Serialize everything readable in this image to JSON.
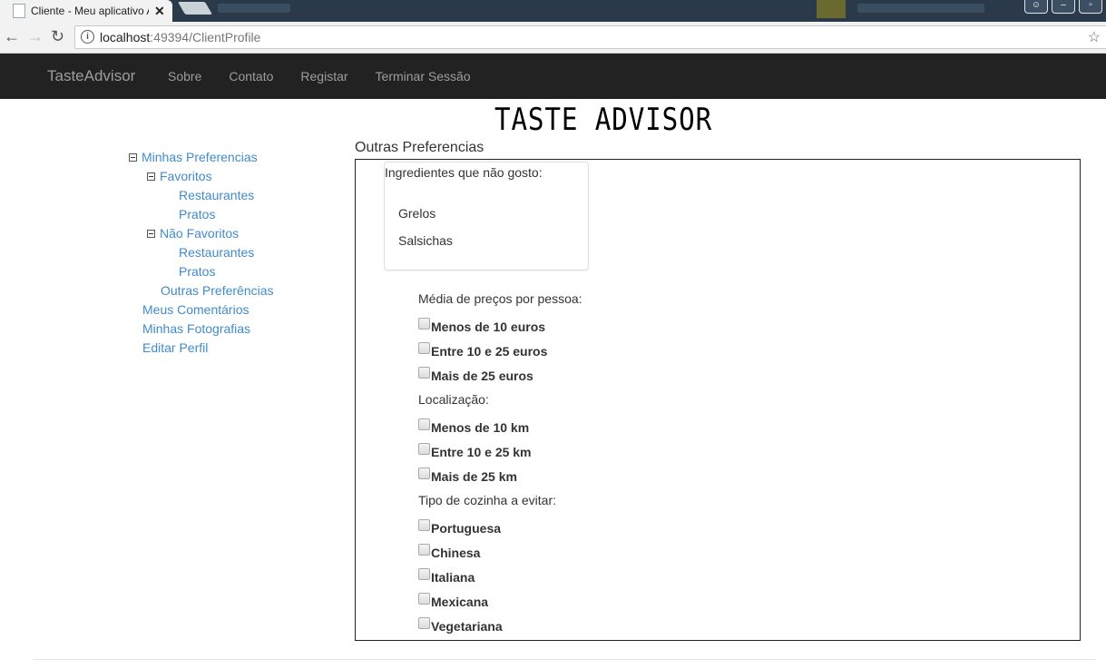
{
  "browser": {
    "tab_title": "Cliente - Meu aplicativo ASP.NET",
    "url_host": "localhost",
    "url_path": ":49394/ClientProfile",
    "icons": [
      "back-icon",
      "forward-icon",
      "reload-icon",
      "info-icon",
      "star-icon",
      "close-icon"
    ]
  },
  "navbar": {
    "brand": "TasteAdvisor",
    "links": [
      "Sobre",
      "Contato",
      "Registar",
      "Terminar Sessão"
    ]
  },
  "logo_text": "TASTE ADVISOR",
  "tree": {
    "root": "Minhas Preferencias",
    "favoritos": "Favoritos",
    "fav_restaurantes": "Restaurantes",
    "fav_pratos": "Pratos",
    "nao_favoritos": "Não Favoritos",
    "nfav_restaurantes": "Restaurantes",
    "nfav_pratos": "Pratos",
    "outras": "Outras Preferências",
    "comentarios": "Meus Comentários",
    "fotografias": "Minhas Fotografias",
    "editar": "Editar Perfil"
  },
  "main": {
    "title": "Outras Preferencias",
    "ingredients_label": "Ingredientes que não gosto:",
    "ingredients": [
      "Grelos",
      "Salsichas"
    ],
    "price_label": "Média de preços por pessoa:",
    "price_options": [
      "Menos de 10 euros",
      "Entre 10 e 25 euros",
      "Mais de 25 euros"
    ],
    "location_label": "Localização:",
    "location_options": [
      "Menos de 10 km",
      "Entre 10 e 25 km",
      "Mais de 25 km"
    ],
    "cuisine_label": "Tipo de cozinha a evitar:",
    "cuisine_options": [
      "Portuguesa",
      "Chinesa",
      "Italiana",
      "Mexicana",
      "Vegetariana"
    ]
  }
}
